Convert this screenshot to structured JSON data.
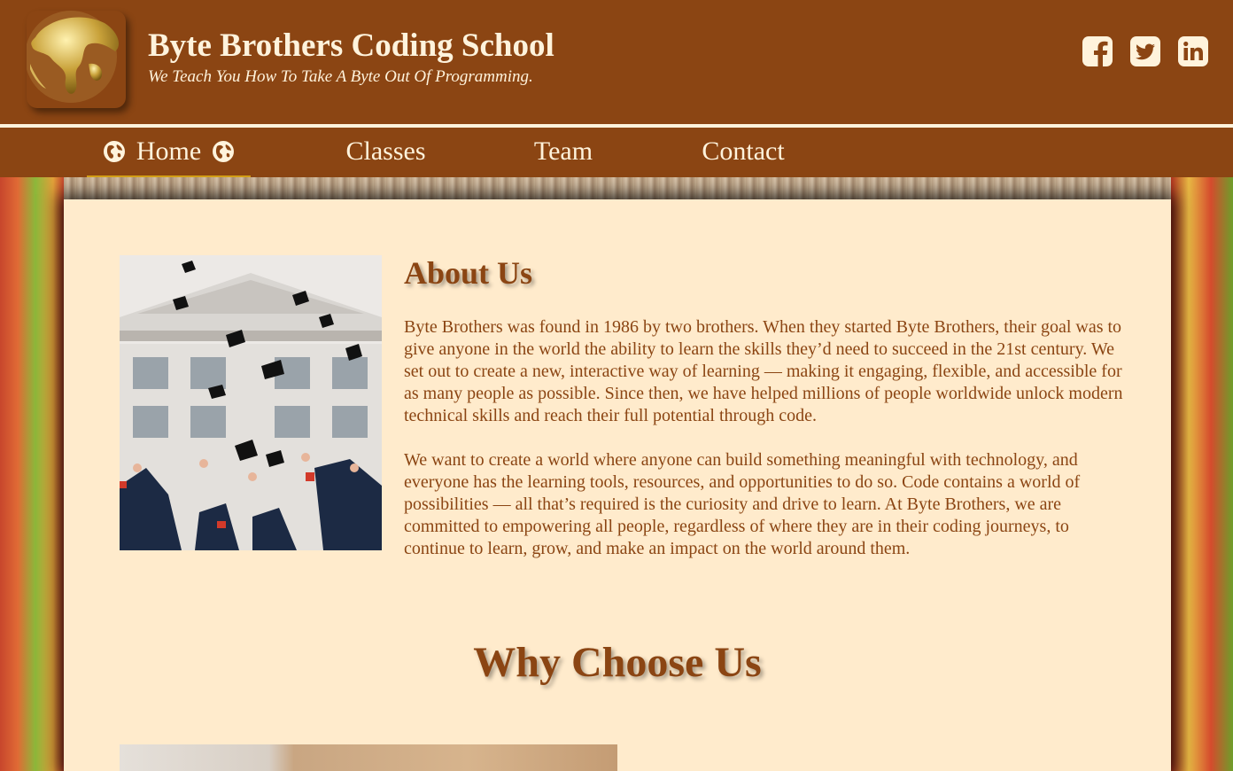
{
  "header": {
    "title": "Byte Brothers Coding School",
    "tagline": "We Teach You How To Take A Byte Out Of Programming.",
    "logo_icon": "globe-logo",
    "social": [
      {
        "name": "facebook-icon"
      },
      {
        "name": "twitter-icon"
      },
      {
        "name": "linkedin-icon"
      }
    ]
  },
  "nav": {
    "items": [
      {
        "label": "Home",
        "active": true
      },
      {
        "label": "Classes",
        "active": false
      },
      {
        "label": "Team",
        "active": false
      },
      {
        "label": "Contact",
        "active": false
      }
    ],
    "active_icon": "globe-icon"
  },
  "about": {
    "title": "About Us",
    "paragraphs": [
      "Byte Brothers was found in 1986 by two brothers. When they started Byte Brothers, their goal was to give anyone in the world the ability to learn the skills they’d need to succeed in the 21st century. We set out to create a new, interactive way of learning — making it engaging, flexible, and accessible for as many people as possible. Since then, we have helped millions of people worldwide unlock modern technical skills and reach their full potential through code.",
      "We want to create a world where anyone can build something meaningful with technology, and everyone has the learning tools, resources, and opportunities to do so. Code contains a world of possibilities — all that’s required is the curiosity and drive to learn. At Byte Brothers, we are committed to empowering all people, regardless of where they are in their coding journeys, to continue to learn, grow, and make an impact on the world around them."
    ]
  },
  "why": {
    "title": "Why Choose Us"
  },
  "colors": {
    "brand": "#8b4513",
    "cream": "#fff3dc",
    "card": "#ffebcc",
    "accent": "#d4a017"
  }
}
